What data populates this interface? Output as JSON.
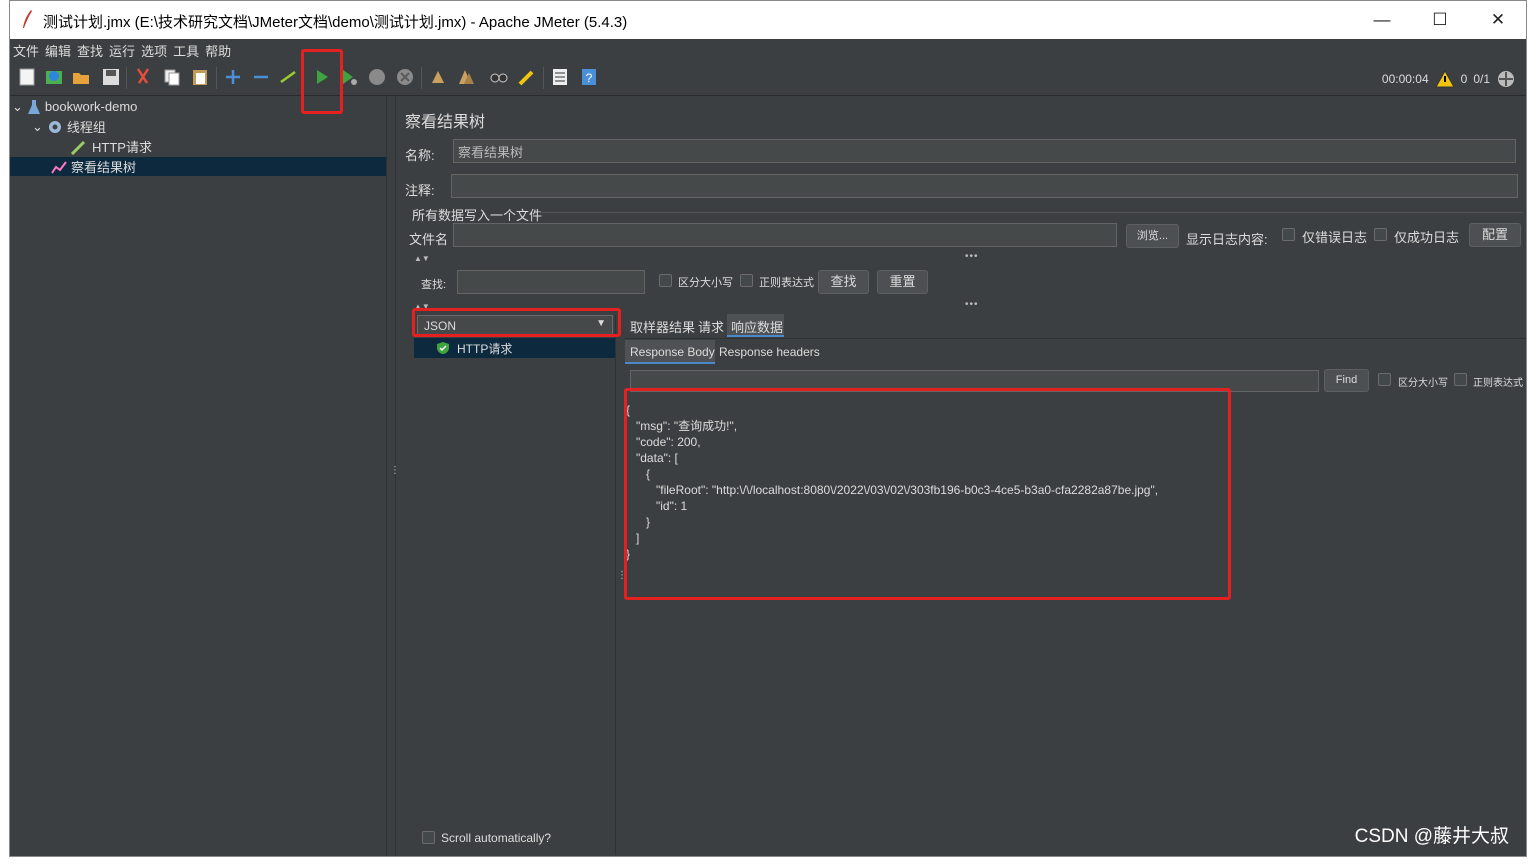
{
  "window": {
    "title": "测试计划.jmx (E:\\技术研究文档\\JMeter文档\\demo\\测试计划.jmx) - Apache JMeter (5.4.3)",
    "minimize": "—",
    "maximize": "☐",
    "close": "✕"
  },
  "menu": [
    "文件",
    "编辑",
    "查找",
    "运行",
    "选项",
    "工具",
    "帮助"
  ],
  "toolbar": {
    "timer": "00:00:04",
    "warnings": "0",
    "threads": "0/1"
  },
  "tree": {
    "root": "bookwork-demo",
    "thread_group": "线程组",
    "http_request": "HTTP请求",
    "listener": "察看结果树"
  },
  "panel": {
    "title": "察看结果树",
    "name_label": "名称:",
    "name_value": "察看结果树",
    "comment_label": "注释:",
    "comment_value": "",
    "file_section": "所有数据写入一个文件",
    "filename_label": "文件名",
    "filename_value": "",
    "browse": "浏览...",
    "log_label": "显示日志内容:",
    "only_errors": "仅错误日志",
    "only_success": "仅成功日志",
    "configure": "配置"
  },
  "search": {
    "label": "查找:",
    "case_sensitive": "区分大小写",
    "regex": "正则表达式",
    "find": "查找",
    "reset": "重置"
  },
  "results": {
    "renderer": "JSON",
    "items": [
      "HTTP请求"
    ],
    "scroll_auto": "Scroll automatically?",
    "tabs": [
      "取样器结果",
      "请求",
      "响应数据"
    ],
    "active_tab": "响应数据",
    "sub_tabs": [
      "Response Body",
      "Response headers"
    ],
    "find_button": "Find",
    "find_case": "区分大小写",
    "find_regex": "正则表达式",
    "body": "{\n   \"msg\": \"查询成功!\",\n   \"code\": 200,\n   \"data\": [\n      {\n         \"fileRoot\": \"http:\\/\\/localhost:8080\\/2022\\/03\\/02\\/303fb196-b0c3-4ce5-b3a0-cfa2282a87be.jpg\",\n         \"id\": 1\n      }\n   ]\n}"
  },
  "watermark": "CSDN @藤井大叔",
  "colors": {
    "background": "#3c3f41",
    "selection": "#0d293e",
    "highlight": "#e52020",
    "run_green": "#3fa33f"
  }
}
